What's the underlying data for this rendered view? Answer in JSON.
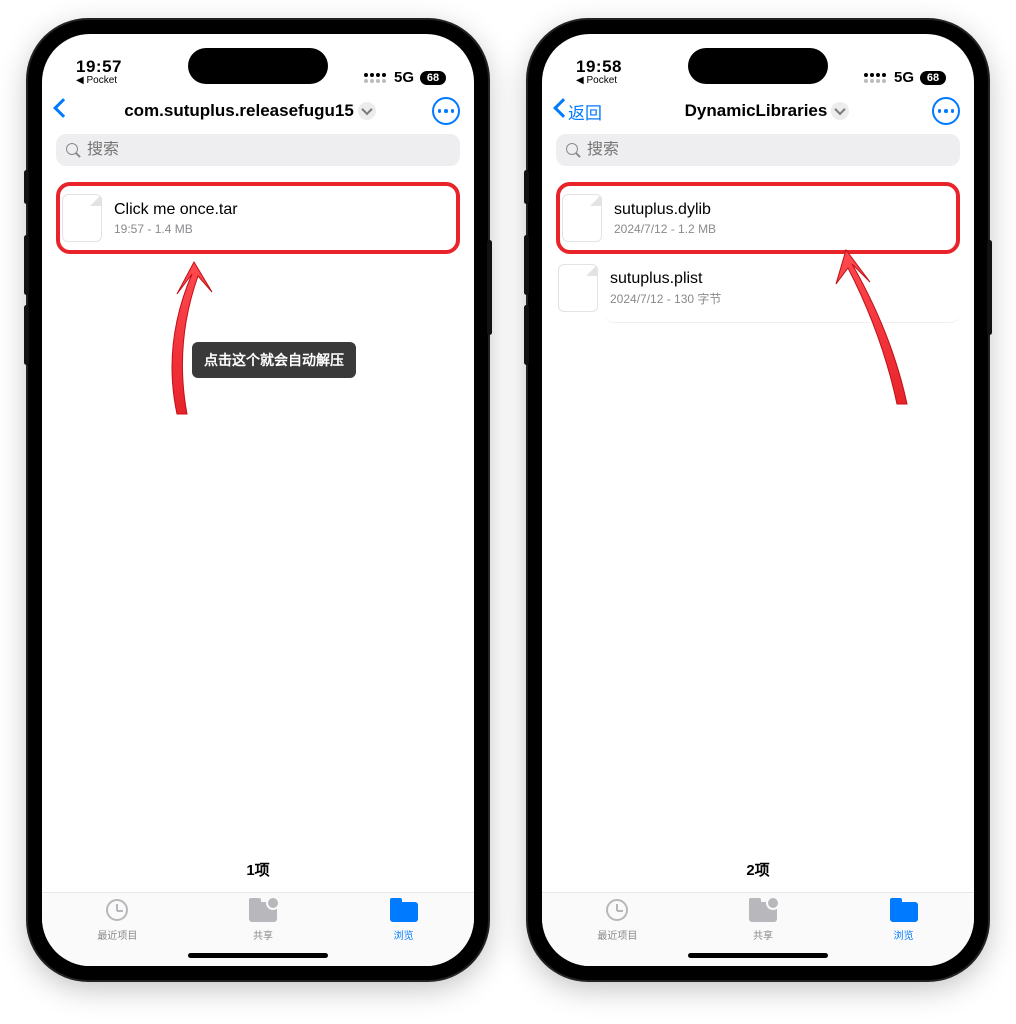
{
  "phones": [
    {
      "status": {
        "time": "19:57",
        "back_app": "◀ Pocket",
        "network": "5G",
        "battery": "68"
      },
      "nav": {
        "back_label": "",
        "title": "com.sutuplus.releasefugu15"
      },
      "search": {
        "placeholder": "搜索"
      },
      "files": [
        {
          "name": "Click me once.tar",
          "meta": "19:57 - 1.4 MB",
          "highlight": true
        }
      ],
      "count": "1项",
      "tabs": {
        "recent": "最近项目",
        "share": "共享",
        "browse": "浏览"
      },
      "tooltip": "点击这个就会自动解压"
    },
    {
      "status": {
        "time": "19:58",
        "back_app": "◀ Pocket",
        "network": "5G",
        "battery": "68"
      },
      "nav": {
        "back_label": "返回",
        "title": "DynamicLibraries"
      },
      "search": {
        "placeholder": "搜索"
      },
      "files": [
        {
          "name": "sutuplus.dylib",
          "meta": "2024/7/12 - 1.2 MB",
          "highlight": true
        },
        {
          "name": "sutuplus.plist",
          "meta": "2024/7/12 - 130 字节",
          "highlight": false
        }
      ],
      "count": "2项",
      "tabs": {
        "recent": "最近项目",
        "share": "共享",
        "browse": "浏览"
      }
    }
  ]
}
